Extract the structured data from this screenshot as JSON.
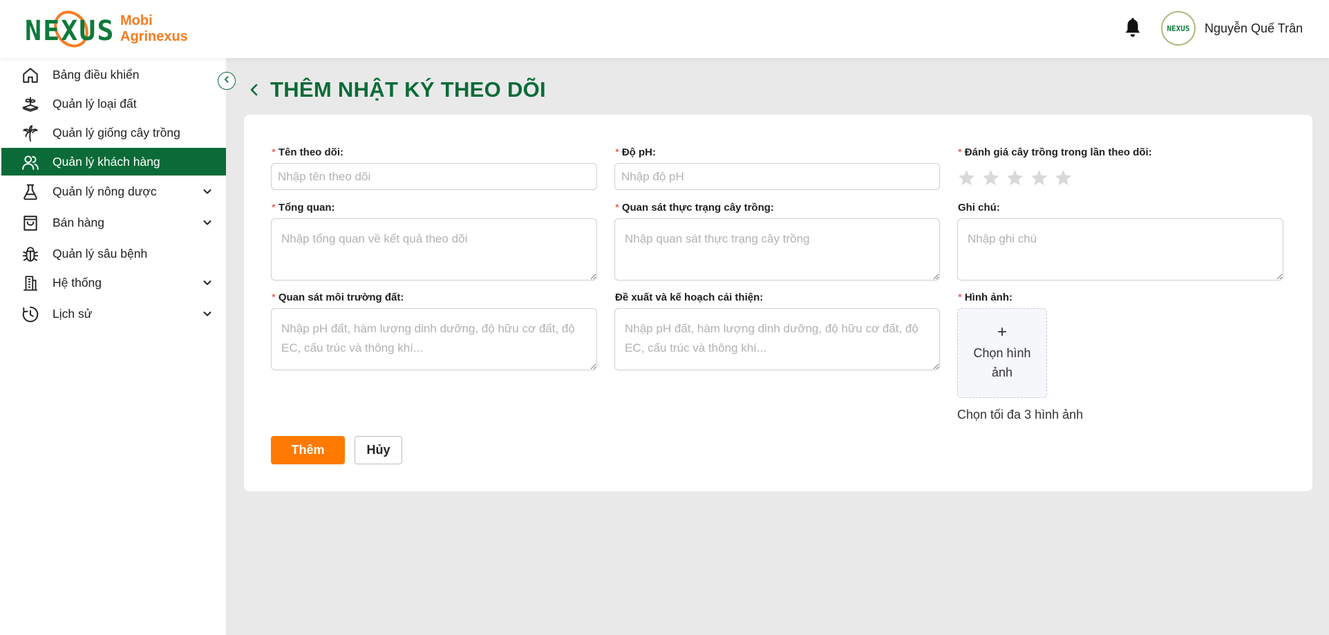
{
  "app": {
    "logo_text_line1": "Mobi",
    "logo_text_line2": "Agrinexus",
    "logo_letters": "NEXUS",
    "brand_green": "#0b6b38",
    "brand_orange": "#ff7a00"
  },
  "header": {
    "user_name": "Nguyễn Quế Trân",
    "avatar_text": "NEXUS",
    "notification_icon": "bell-icon"
  },
  "sidebar": {
    "items": [
      {
        "label": "Bảng điều khiển",
        "icon": "home-icon",
        "has_submenu": false,
        "active": false
      },
      {
        "label": "Quản lý loại đất",
        "icon": "soil-icon",
        "has_submenu": false,
        "active": false
      },
      {
        "label": "Quản lý giống cây trồng",
        "icon": "palm-tree-icon",
        "has_submenu": false,
        "active": false
      },
      {
        "label": "Quản lý khách hàng",
        "icon": "users-icon",
        "has_submenu": false,
        "active": true
      },
      {
        "label": "Quản lý nông dược",
        "icon": "flask-icon",
        "has_submenu": true,
        "active": false
      },
      {
        "label": "Bán hàng",
        "icon": "shopping-bag-icon",
        "has_submenu": true,
        "active": false
      },
      {
        "label": "Quản lý sâu bệnh",
        "icon": "bug-icon",
        "has_submenu": false,
        "active": false
      },
      {
        "label": "Hệ thống",
        "icon": "building-icon",
        "has_submenu": true,
        "active": false
      },
      {
        "label": "Lịch sử",
        "icon": "clock-icon",
        "has_submenu": true,
        "active": false
      }
    ]
  },
  "page": {
    "title": "THÊM NHẬT KÝ THEO DÕI"
  },
  "form": {
    "name": {
      "label": "Tên theo dõi:",
      "required": true,
      "placeholder": "Nhập tên theo dõi",
      "value": ""
    },
    "ph": {
      "label": "Độ pH:",
      "required": true,
      "placeholder": "Nhập độ pH",
      "value": ""
    },
    "rating": {
      "label": "Đánh giá cây trồng trong lần theo dõi:",
      "required": true,
      "max": 5,
      "value": 0
    },
    "overview": {
      "label": "Tổng quan:",
      "required": true,
      "placeholder": "Nhập tổng quan về kết quả theo dõi"
    },
    "crop_observation": {
      "label": "Quan sát thực trạng cây trồng:",
      "required": true,
      "placeholder": "Nhập quan sát thực trạng cây trồng"
    },
    "note": {
      "label": "Ghi chú:",
      "required": false,
      "placeholder": "Nhập ghi chú"
    },
    "soil_observation": {
      "label": "Quan sát môi trường đất:",
      "required": true,
      "placeholder": "Nhập pH đất, hàm lượng dinh dưỡng, độ hữu cơ đất, độ EC, cấu trúc và thông khí..."
    },
    "improvement_plan": {
      "label": "Đề xuất và kế hoạch cải thiện:",
      "required": false,
      "placeholder": "Nhập pH đất, hàm lượng dinh dưỡng, độ hữu cơ đất, độ EC, cấu trúc và thông khí..."
    },
    "images": {
      "label": "Hình ảnh:",
      "required": true,
      "plus": "+",
      "button_label": "Chọn hình ảnh",
      "hint": "Chọn tối đa 3 hình ảnh"
    },
    "required_mark": "*"
  },
  "actions": {
    "submit_label": "Thêm",
    "cancel_label": "Hủy"
  }
}
